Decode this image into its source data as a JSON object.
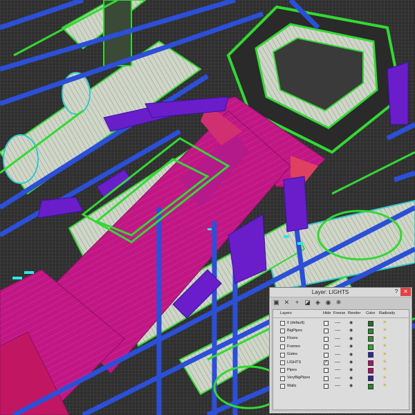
{
  "dialog": {
    "title": "Layer: LIGHTS",
    "help": "?",
    "close": "✕",
    "columns": [
      "Layers",
      "Hide",
      "Freeze",
      "Render",
      "Color",
      "Radiosity"
    ],
    "toolbar": [
      "new-layer-icon",
      "delete-layer-icon",
      "add-to-layer-icon",
      "select-objects-icon",
      "highlight-icon",
      "hide-all-icon",
      "freeze-all-icon"
    ],
    "layers": [
      {
        "name": "0 (default)",
        "hide": false,
        "color": "#2a6a2a"
      },
      {
        "name": "BigPipes",
        "hide": false,
        "color": "#2a8a2a"
      },
      {
        "name": "Floors",
        "hide": false,
        "color": "#3a8a3a"
      },
      {
        "name": "Frames",
        "hide": false,
        "color": "#2aa82a"
      },
      {
        "name": "Gates",
        "hide": false,
        "color": "#2a2aa8"
      },
      {
        "name": "LIGHTS",
        "hide": true,
        "color": "#b01070"
      },
      {
        "name": "Pipes",
        "hide": false,
        "color": "#b0106a"
      },
      {
        "name": "VeryBigPipes",
        "hide": false,
        "color": "#2a2a9a"
      },
      {
        "name": "Walls",
        "hide": false,
        "color": "#2a8a2a"
      }
    ]
  },
  "scene": {
    "pipe_color": "#2b4fd6",
    "frame_color": "#33d933",
    "floor_color": "#c01586",
    "pipe_body_color": "#cfd6c8"
  }
}
